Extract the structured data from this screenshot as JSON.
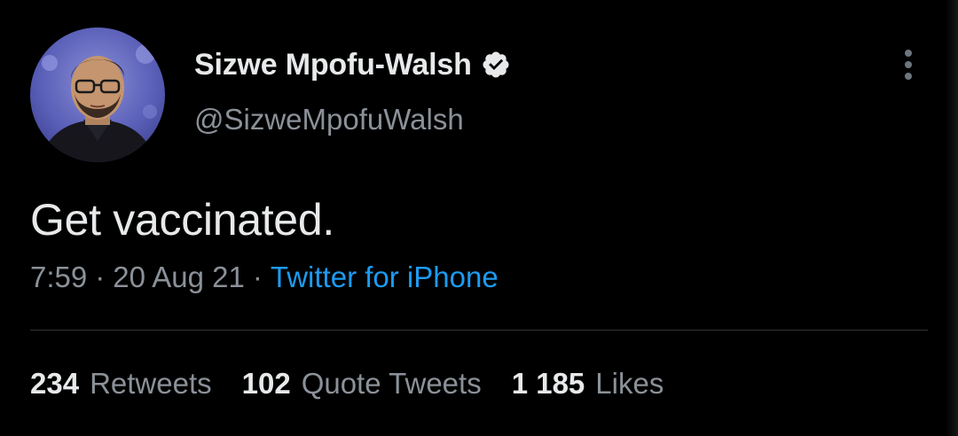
{
  "author": {
    "display_name": "Sizwe Mpofu-Walsh",
    "handle": "@SizweMpofuWalsh",
    "verified": true
  },
  "tweet": {
    "text": "Get vaccinated.",
    "time": "7:59",
    "date": "20 Aug 21",
    "separator": "·",
    "source": "Twitter for iPhone"
  },
  "stats": {
    "retweets_count": "234",
    "retweets_label": "Retweets",
    "quotes_count": "102",
    "quotes_label": "Quote Tweets",
    "likes_count": "1 185",
    "likes_label": "Likes"
  },
  "icons": {
    "verified": "verified-badge-icon",
    "more": "more-vertical-icon"
  },
  "colors": {
    "background": "#000000",
    "text_primary": "#e7e9ea",
    "text_secondary": "#8b9198",
    "link": "#1d9bf0",
    "divider": "#2f3336"
  }
}
